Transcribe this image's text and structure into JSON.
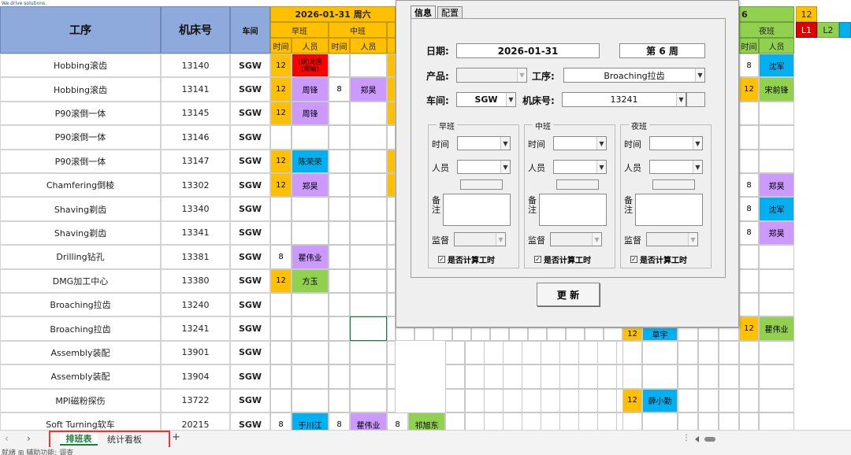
{
  "logo_tagline": "We drive solutions.",
  "title_fragment": "ᔆ",
  "date_header": "2026-01-31 周六",
  "date_header_right": "6",
  "top_right": {
    "value": "12",
    "l1": "L1",
    "l2": "L2",
    "l3": ""
  },
  "headers": {
    "process": "工序",
    "machine": "机床号",
    "workshop": "车间",
    "time": "时间",
    "person": "人员"
  },
  "shifts": {
    "morning": "早班",
    "middle": "中班",
    "night": "夜班"
  },
  "rows": [
    {
      "process": "Hobbing滚齿",
      "machine": "13140",
      "workshop": "SGW",
      "m_time": "12",
      "m_person": "(胡)龙国\n(周瑜)",
      "d_time": "",
      "d_person": "",
      "e_time": "",
      "e_person": "",
      "r_time": "8",
      "r_person": "沈军"
    },
    {
      "process": "Hobbing滚齿",
      "machine": "13141",
      "workshop": "SGW",
      "m_time": "12",
      "m_person": "周锋",
      "d_time": "8",
      "d_person": "郑昊",
      "e_time": "",
      "e_person": "",
      "r_time": "12",
      "r_person": "宋前锋"
    },
    {
      "process": "P90滚倒一体",
      "machine": "13145",
      "workshop": "SGW",
      "m_time": "12",
      "m_person": "周锋",
      "d_time": "",
      "d_person": "",
      "e_time": "",
      "e_person": "",
      "r_time": "",
      "r_person": ""
    },
    {
      "process": "P90滚倒一体",
      "machine": "13146",
      "workshop": "SGW",
      "m_time": "",
      "m_person": "",
      "d_time": "",
      "d_person": "",
      "e_time": "",
      "e_person": "",
      "r_time": "",
      "r_person": ""
    },
    {
      "process": "P90滚倒一体",
      "machine": "13147",
      "workshop": "SGW",
      "m_time": "12",
      "m_person": "陈荣荣",
      "d_time": "",
      "d_person": "",
      "e_time": "",
      "e_person": "",
      "r_time": "",
      "r_person": ""
    },
    {
      "process": "Chamfering倒棱",
      "machine": "13302",
      "workshop": "SGW",
      "m_time": "12",
      "m_person": "郑昊",
      "d_time": "",
      "d_person": "",
      "e_time": "",
      "e_person": "",
      "r_time": "8",
      "r_person": "郑昊"
    },
    {
      "process": "Shaving剃齿",
      "machine": "13340",
      "workshop": "SGW",
      "m_time": "",
      "m_person": "",
      "d_time": "",
      "d_person": "",
      "e_time": "",
      "e_person": "",
      "r_time": "8",
      "r_person": "沈军"
    },
    {
      "process": "Shaving剃齿",
      "machine": "13341",
      "workshop": "SGW",
      "m_time": "",
      "m_person": "",
      "d_time": "",
      "d_person": "",
      "e_time": "",
      "e_person": "",
      "r_time": "8",
      "r_person": "郑昊"
    },
    {
      "process": "Drilling钻孔",
      "machine": "13381",
      "workshop": "SGW",
      "m_time": "8",
      "m_person": "瞿伟业",
      "d_time": "",
      "d_person": "",
      "e_time": "",
      "e_person": "",
      "r_time": "",
      "r_person": ""
    },
    {
      "process": "DMG加工中心",
      "machine": "13380",
      "workshop": "SGW",
      "m_time": "12",
      "m_person": "方玉",
      "d_time": "",
      "d_person": "",
      "e_time": "",
      "e_person": "",
      "r_time": "",
      "r_person": ""
    },
    {
      "process": "Broaching拉齿",
      "machine": "13240",
      "workshop": "SGW",
      "m_time": "",
      "m_person": "",
      "d_time": "",
      "d_person": "",
      "e_time": "",
      "e_person": "",
      "r_time": "",
      "r_person": ""
    },
    {
      "process": "Broaching拉齿",
      "machine": "13241",
      "workshop": "SGW",
      "m_time": "",
      "m_person": "",
      "d_time": "",
      "d_person": "",
      "e_time": "12",
      "e_person": "草宇",
      "r_time": "12",
      "r_person": "瞿伟业"
    },
    {
      "process": "Assembly装配",
      "machine": "13901",
      "workshop": "SGW",
      "m_time": "",
      "m_person": "",
      "d_time": "",
      "d_person": "",
      "e_time": "",
      "e_person": "",
      "r_time": "",
      "r_person": ""
    },
    {
      "process": "Assembly装配",
      "machine": "13904",
      "workshop": "SGW",
      "m_time": "",
      "m_person": "",
      "d_time": "",
      "d_person": "",
      "e_time": "",
      "e_person": "",
      "r_time": "",
      "r_person": ""
    },
    {
      "process": "MPI磁粉探伤",
      "machine": "13722",
      "workshop": "SGW",
      "m_time": "",
      "m_person": "",
      "d_time": "",
      "d_person": "",
      "e_time": "12",
      "e_person": "薛小勤",
      "r_time": "",
      "r_person": ""
    },
    {
      "process": "Soft Turning软车",
      "machine": "20215",
      "workshop": "SGW",
      "m_time": "8",
      "m_person": "于川江",
      "d_time": "8",
      "d_person": "瞿伟业",
      "d2_time": "8",
      "d2_person": "祁旭东",
      "e_time": "",
      "e_person": "",
      "r_time": "",
      "r_person": ""
    }
  ],
  "dialog": {
    "tabs": {
      "info": "信息",
      "config": "配置"
    },
    "date_label": "日期:",
    "date_value": "2026-01-31",
    "week_value": "第 6 周",
    "product_label": "产品:",
    "product_value": "",
    "process_label": "工序:",
    "process_value": "Broaching拉齿",
    "workshop_label": "车间:",
    "workshop_value": "SGW",
    "machine_label": "机床号:",
    "machine_value": "13241",
    "groups": [
      {
        "title": "早班",
        "time_label": "时间",
        "person_label": "人员",
        "note_label": "备\n注",
        "supervisor_label": "监督",
        "checkbox_label": "是否计算工时"
      },
      {
        "title": "中班",
        "time_label": "时间",
        "person_label": "人员",
        "note_label": "备\n注",
        "supervisor_label": "监督",
        "checkbox_label": "是否计算工时"
      },
      {
        "title": "夜班",
        "time_label": "时间",
        "person_label": "人员",
        "note_label": "备\n注",
        "supervisor_label": "监督",
        "checkbox_label": "是否计算工时"
      }
    ],
    "update_button": "更 新"
  },
  "sheet_tabs": [
    "排班表",
    "统计看板"
  ],
  "add_tab": "+",
  "status_text": "就绪  ⊞  辅助功能: 调查"
}
